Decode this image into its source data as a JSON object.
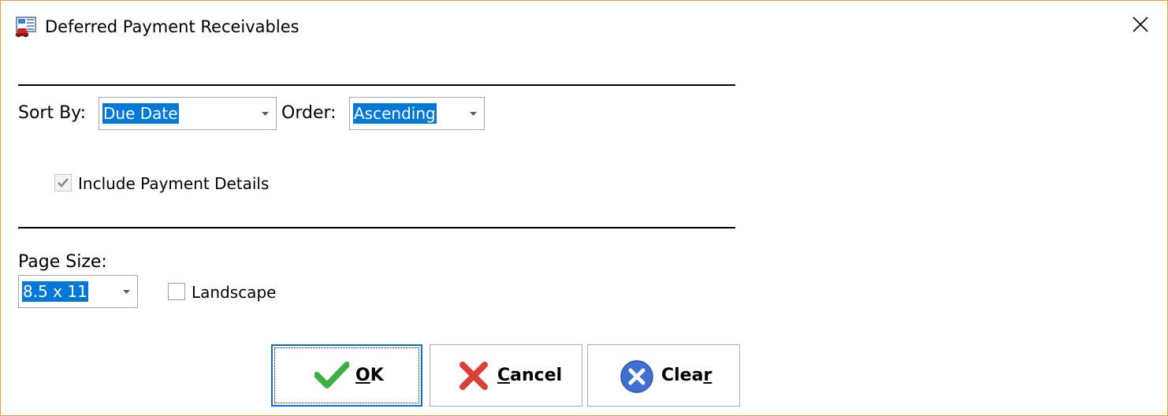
{
  "window": {
    "title": "Deferred Payment Receivables",
    "icon": "report-icon",
    "border_color": "#e8a33d"
  },
  "sort": {
    "sort_by_label": "Sort By:",
    "sort_by_value": "Due Date",
    "order_label": "Order:",
    "order_value": "Ascending"
  },
  "options": {
    "include_payment_details_label": "Include Payment Details",
    "include_payment_details_checked": true,
    "include_payment_details_enabled": false
  },
  "page": {
    "page_size_label": "Page Size:",
    "page_size_value": "8.5 x 11",
    "landscape_label": "Landscape",
    "landscape_checked": false
  },
  "buttons": {
    "ok": {
      "mnemonic": "O",
      "rest": "K",
      "icon": "checkmark-icon"
    },
    "cancel": {
      "mnemonic": "C",
      "rest": "ancel",
      "icon": "x-mark-icon"
    },
    "clear": {
      "lead": "Clea",
      "mnemonic": "r",
      "icon": "circle-x-icon"
    }
  },
  "colors": {
    "selection": "#0078d7",
    "ok_green": "#3cb043",
    "cancel_red": "#d9413a",
    "clear_blue": "#3e6fd1"
  }
}
